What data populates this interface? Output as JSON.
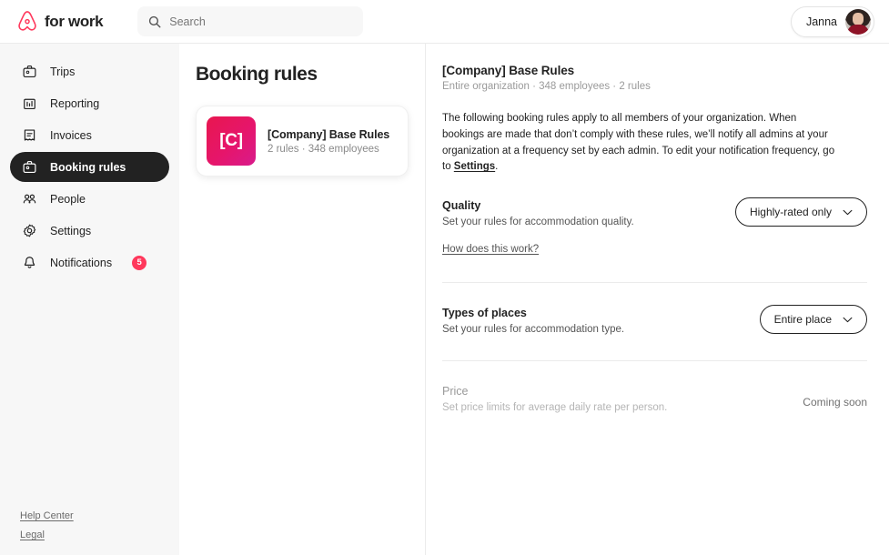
{
  "header": {
    "brand_text": "for work",
    "logo_color": "#ff385c",
    "search": {
      "placeholder": "Search",
      "value": ""
    },
    "user": {
      "name": "Janna"
    }
  },
  "sidebar": {
    "items": [
      {
        "label": "Trips",
        "icon": "briefcase-icon",
        "active": false
      },
      {
        "label": "Reporting",
        "icon": "bar-chart-icon",
        "active": false
      },
      {
        "label": "Invoices",
        "icon": "receipt-icon",
        "active": false
      },
      {
        "label": "Booking rules",
        "icon": "briefcase-icon",
        "active": true
      },
      {
        "label": "People",
        "icon": "people-icon",
        "active": false
      },
      {
        "label": "Settings",
        "icon": "gear-icon",
        "active": false
      },
      {
        "label": "Notifications",
        "icon": "bell-icon",
        "active": false,
        "badge": "5"
      }
    ],
    "footer_links": [
      {
        "label": "Help Center"
      },
      {
        "label": "Legal"
      }
    ]
  },
  "middle": {
    "page_title": "Booking rules",
    "cards": [
      {
        "thumb_text": "[C]",
        "thumb_color": "#e6156b",
        "name": "[Company] Base Rules",
        "meta": "2 rules  ·  348 employees"
      }
    ]
  },
  "panel": {
    "title": "[Company] Base Rules",
    "subtitle": "Entire organization  ·  348 employees ·  2 rules",
    "description_part1": "The following booking rules apply to all members of your organization. When bookings are made that don’t comply with these rules, we’ll notify all admins at your organization at a frequency set by each admin. To edit your notification frequency, go to ",
    "description_link": "Settings",
    "description_part2": ".",
    "sections": [
      {
        "title": "Quality",
        "description": "Set your rules for accommodation quality.",
        "control_type": "dropdown",
        "control_value": "Highly-rated only",
        "helper_link": "How does this work?",
        "disabled": false
      },
      {
        "title": "Types of places",
        "description": "Set your rules for accommodation type.",
        "control_type": "dropdown",
        "control_value": "Entire place",
        "helper_link": "",
        "disabled": false
      },
      {
        "title": "Price",
        "description": "Set price limits for average daily rate per person.",
        "control_type": "status",
        "control_value": "Coming soon",
        "helper_link": "",
        "disabled": true
      }
    ]
  }
}
